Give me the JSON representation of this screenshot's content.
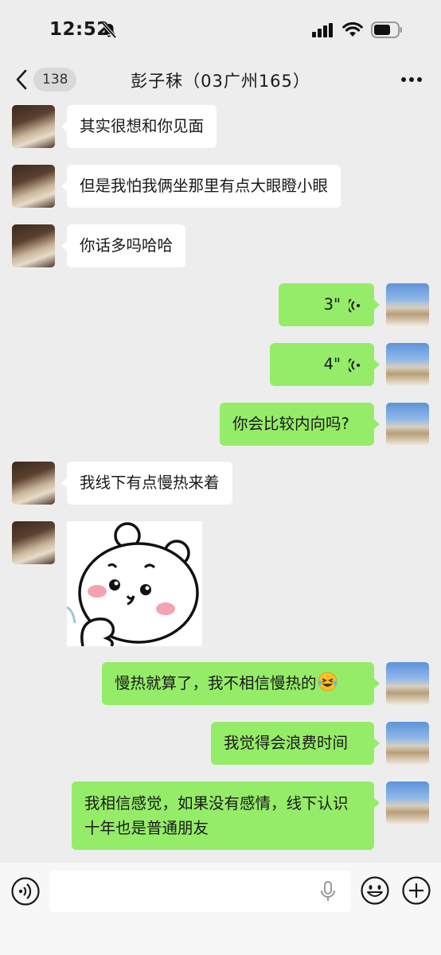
{
  "status_bar": {
    "time": "12:52",
    "icons": [
      "bell-slash-icon",
      "cellular-signal-icon",
      "wifi-icon",
      "battery-icon"
    ]
  },
  "nav": {
    "back_icon": "chevron-left-icon",
    "unread_count": "138",
    "title": "彭子秣（03广州165）",
    "more_icon": "more-dots-icon"
  },
  "messages": [
    {
      "side": "left",
      "type": "text",
      "text": "其实很想和你见面"
    },
    {
      "side": "left",
      "type": "text",
      "text": "但是我怕我俩坐那里有点大眼瞪小眼"
    },
    {
      "side": "left",
      "type": "text",
      "text": "你话多吗哈哈"
    },
    {
      "side": "right",
      "type": "voice",
      "text": "3\"",
      "seconds": 3
    },
    {
      "side": "right",
      "type": "voice",
      "text": "4\"",
      "seconds": 4
    },
    {
      "side": "right",
      "type": "text",
      "text": "你会比较内向吗?"
    },
    {
      "side": "left",
      "type": "text",
      "text": "我线下有点慢热来着"
    },
    {
      "side": "left",
      "type": "sticker",
      "sticker": "white-bear-thinking-sticker"
    },
    {
      "side": "right",
      "type": "text",
      "text": "慢热就算了，我不相信慢热的",
      "emoji": "laughing-crying-emoji"
    },
    {
      "side": "right",
      "type": "text",
      "text": "我觉得会浪费时间"
    },
    {
      "side": "right",
      "type": "text",
      "text": "我相信感觉，如果没有感情，线下认识十年也是普通朋友"
    }
  ],
  "input_bar": {
    "placeholder": "",
    "icons": [
      "voice-mode-icon",
      "microphone-icon",
      "emoji-icon",
      "plus-icon"
    ]
  },
  "colors": {
    "background": "#ededed",
    "incoming_bubble": "#ffffff",
    "outgoing_bubble": "#95ec69",
    "badge": "#d9d9d9",
    "input_bar": "#f7f7f7"
  }
}
